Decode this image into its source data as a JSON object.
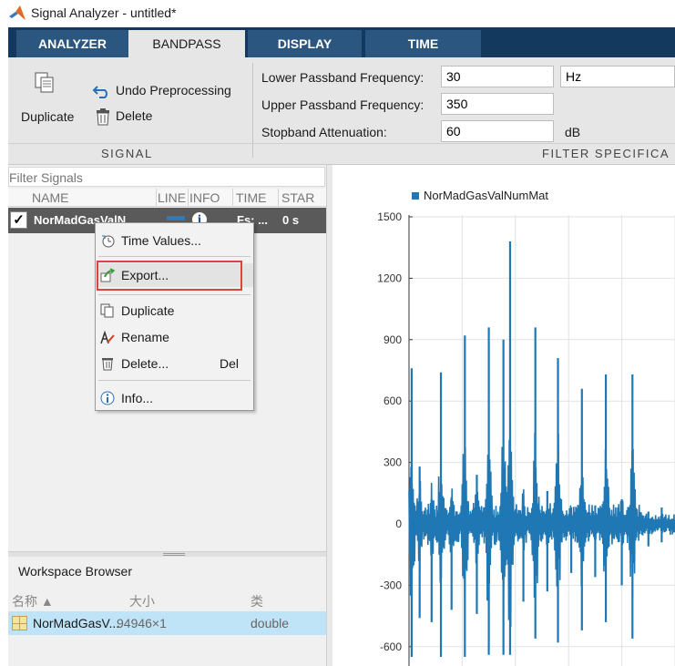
{
  "window": {
    "title": "Signal Analyzer - untitled*"
  },
  "tabs": [
    {
      "label": "ANALYZER",
      "active": false
    },
    {
      "label": "BANDPASS",
      "active": true
    },
    {
      "label": "DISPLAY",
      "active": false
    },
    {
      "label": "TIME",
      "active": false
    }
  ],
  "ribbon": {
    "signal_section": {
      "label": "SIGNAL",
      "duplicate_label": "Duplicate",
      "undo_label": "Undo Preprocessing",
      "delete_label": "Delete"
    },
    "filter_section": {
      "label": "FILTER SPECIFICA",
      "lower_label": "Lower Passband Frequency:",
      "lower_value": "30",
      "lower_unit": "Hz",
      "upper_label": "Upper Passband Frequency:",
      "upper_value": "350",
      "stop_label": "Stopband Attenuation:",
      "stop_value": "60",
      "stop_unit": "dB"
    }
  },
  "signal_table": {
    "filter_placeholder": "Filter Signals",
    "columns": [
      "NAME",
      "LINE",
      "INFO",
      "TIME",
      "STAR"
    ],
    "rows": [
      {
        "checked": true,
        "name": "NorMadGasValN",
        "time": "Fs: ...",
        "start": "0 s"
      }
    ]
  },
  "context_menu": {
    "items": [
      {
        "label": "Time Values...",
        "icon": "clock-icon"
      },
      {
        "label": "Export...",
        "icon": "export-icon",
        "highlighted": true
      },
      {
        "label": "Duplicate",
        "icon": "duplicate-icon"
      },
      {
        "label": "Rename",
        "icon": "rename-icon"
      },
      {
        "label": "Delete...",
        "icon": "trash-icon",
        "shortcut": "Del"
      },
      {
        "label": "Info...",
        "icon": "info-icon"
      }
    ]
  },
  "workspace_browser": {
    "title": "Workspace Browser",
    "columns": [
      "名称 ▲",
      "大小",
      "类"
    ],
    "rows": [
      {
        "name": "NorMadGasV...",
        "size": "94946×1",
        "class": "double"
      }
    ]
  },
  "colors": {
    "series": "#1f77b4",
    "tabbar": "#14395e",
    "selected_row": "#5a5a5a",
    "highlight_border": "#e04141",
    "ws_selected": "#bfe3f7"
  },
  "chart_data": {
    "type": "line",
    "legend": [
      "NorMadGasValNumMat"
    ],
    "legend_position": "top-left",
    "y_ticks": [
      1500,
      1200,
      900,
      600,
      300,
      0,
      -300,
      -600
    ],
    "y_visible_range": [
      -660,
      1500
    ],
    "grid": true,
    "series": [
      {
        "name": "NorMadGasValNumMat",
        "color": "#1f77b4",
        "spikes": [
          {
            "x": 0.01,
            "max": 760,
            "min": -650
          },
          {
            "x": 0.04,
            "max": 280,
            "min": -460
          },
          {
            "x": 0.085,
            "max": 120,
            "min": -480
          },
          {
            "x": 0.12,
            "max": 740,
            "min": -650
          },
          {
            "x": 0.16,
            "max": 130,
            "min": -420
          },
          {
            "x": 0.21,
            "max": 920,
            "min": -650
          },
          {
            "x": 0.255,
            "max": 240,
            "min": -440
          },
          {
            "x": 0.3,
            "max": 960,
            "min": -640
          },
          {
            "x": 0.355,
            "max": 900,
            "min": -640
          },
          {
            "x": 0.38,
            "max": 1380,
            "min": -640
          },
          {
            "x": 0.43,
            "max": 140,
            "min": -380
          },
          {
            "x": 0.475,
            "max": 960,
            "min": -560
          },
          {
            "x": 0.52,
            "max": 160,
            "min": -330
          },
          {
            "x": 0.56,
            "max": 810,
            "min": -580
          },
          {
            "x": 0.61,
            "max": 80,
            "min": -240
          },
          {
            "x": 0.65,
            "max": 660,
            "min": -520
          },
          {
            "x": 0.7,
            "max": 90,
            "min": -260
          },
          {
            "x": 0.74,
            "max": 730,
            "min": -480
          },
          {
            "x": 0.8,
            "max": 120,
            "min": -300
          },
          {
            "x": 0.84,
            "max": 730,
            "min": -560
          },
          {
            "x": 0.9,
            "max": 60,
            "min": -110
          },
          {
            "x": 0.95,
            "max": 80,
            "min": -90
          }
        ]
      }
    ]
  }
}
